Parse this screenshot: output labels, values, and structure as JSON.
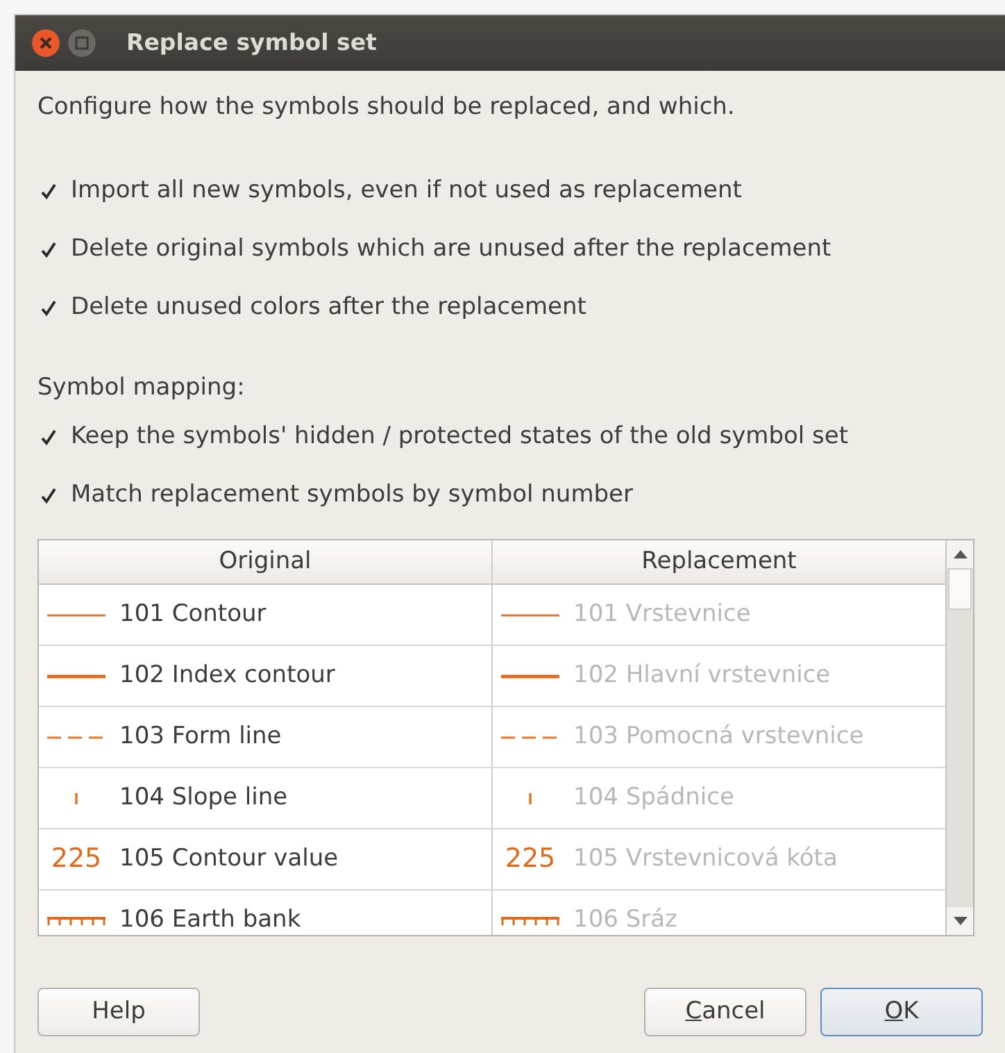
{
  "window": {
    "title": "Replace symbol set"
  },
  "intro": "Configure how the symbols should be replaced, and which.",
  "options": [
    {
      "label": "Import all new symbols, even if not used as replacement",
      "checked": true
    },
    {
      "label": "Delete original symbols which are unused after the replacement",
      "checked": true
    },
    {
      "label": "Delete unused colors after the replacement",
      "checked": true
    }
  ],
  "mapping_label": "Symbol mapping:",
  "mapping_options": [
    {
      "label": "Keep the symbols' hidden / protected states of the old symbol set",
      "checked": true
    },
    {
      "label": "Match replacement symbols by symbol number",
      "checked": true
    }
  ],
  "table": {
    "columns": [
      "Original",
      "Replacement"
    ],
    "rows": [
      {
        "kind": "line",
        "original": "101 Contour",
        "replacement": "101 Vrstevnice",
        "replacement_disabled": true
      },
      {
        "kind": "thick",
        "original": "102 Index contour",
        "replacement": "102 Hlavní vrstevnice",
        "replacement_disabled": true
      },
      {
        "kind": "dashed",
        "original": "103 Form line",
        "replacement": "103 Pomocná vrstevnice",
        "replacement_disabled": true
      },
      {
        "kind": "tick",
        "original": "104 Slope line",
        "replacement": "104 Spádnice",
        "replacement_disabled": true
      },
      {
        "kind": "text",
        "symbol_text": "225",
        "replacement_symbol_text": "225",
        "original": "105 Contour value",
        "replacement": "105 Vrstevnicová kóta",
        "replacement_disabled": true
      },
      {
        "kind": "bank",
        "original": "106 Earth bank",
        "replacement": "106 Sráz",
        "replacement_disabled": true
      }
    ]
  },
  "buttons": [
    {
      "rest": "Help",
      "default": false
    },
    {
      "mnemonic": "C",
      "rest": "ancel",
      "default": false
    },
    {
      "mnemonic": "O",
      "rest": "K",
      "default": true
    }
  ]
}
